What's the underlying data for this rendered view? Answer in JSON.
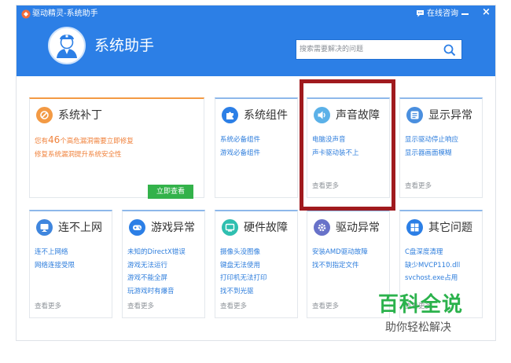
{
  "app": {
    "window_title": "驱动精灵-系统助手",
    "online_consult": "在线咨询",
    "page_title": "系统助手"
  },
  "search": {
    "placeholder": "搜索需要解决的问题"
  },
  "cards": {
    "patch": {
      "title": "系统补丁",
      "line1_prefix": "您有",
      "line1_count": "46",
      "line1_suffix": "个高危漏洞需要立即修复",
      "line2": "修复系统漏洞提升系统安全性",
      "button": "立即查看"
    },
    "components": {
      "title": "系统组件",
      "links": [
        "系统必备组件",
        "游戏必备组件"
      ]
    },
    "sound": {
      "title": "声音故障",
      "links": [
        "电脑没声音",
        "声卡驱动装不上"
      ],
      "more": "查看更多"
    },
    "display": {
      "title": "显示异常",
      "links": [
        "显示驱动停止响应",
        "显示器画面模糊"
      ],
      "more": "查看更多"
    },
    "network": {
      "title": "连不上网",
      "links": [
        "连不上网络",
        "网络连接受限"
      ],
      "more": "查看更多"
    },
    "game": {
      "title": "游戏异常",
      "links": [
        "未知的DirectX错误",
        "游戏无法运行",
        "游戏不能全屏",
        "玩游戏时有爆音"
      ],
      "more": "查看更多"
    },
    "hardware": {
      "title": "硬件故障",
      "links": [
        "摄像头没图像",
        "键盘无法使用",
        "打印机无法打印",
        "找不到光驱"
      ],
      "more": "查看更多"
    },
    "driver": {
      "title": "驱动异常",
      "links": [
        "安装AMD驱动故障",
        "找不到指定文件"
      ],
      "more": "查看更多"
    },
    "other": {
      "title": "其它问题",
      "links": [
        "C盘深度清理",
        "缺少MVCP110.dll",
        "svchost.exe占用"
      ],
      "more": "查看更多"
    }
  },
  "watermark": {
    "title": "百科全说",
    "subtitle": "助你轻松解决"
  },
  "colors": {
    "header_blue": "#2c7fe6",
    "accent_orange": "#f0823c",
    "link_blue": "#2d7ddc",
    "button_green": "#33b24a",
    "highlight_red": "#a01a1e",
    "watermark_green": "#2bb24c"
  },
  "icons": {
    "app": "app-logo-icon",
    "chat": "chat-bubble-icon",
    "search": "search-icon",
    "patch": "patch-wrench-icon",
    "components": "puzzle-piece-icon",
    "sound": "speaker-icon",
    "display": "monitor-icon",
    "network": "computer-icon",
    "game": "gamepad-icon",
    "hardware": "hardware-device-icon",
    "driver": "gear-icon",
    "other": "windows-icon"
  }
}
